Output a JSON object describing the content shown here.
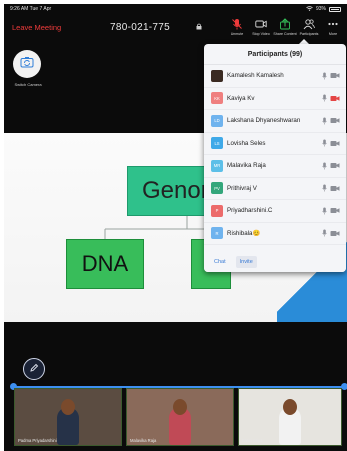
{
  "status_bar": {
    "time": "9:26 AM  Tue 7 Apr",
    "battery": "93%"
  },
  "toolbar": {
    "leave_label": "Leave Meeting",
    "meeting_id": "780-021-775",
    "tools": [
      {
        "label": "Unmute",
        "icon": "microphone-muted-icon",
        "color": "#ef3b3b"
      },
      {
        "label": "Stop Video",
        "icon": "video-camera-icon",
        "color": "#d9d9d9"
      },
      {
        "label": "Share Content",
        "icon": "share-arrow-icon",
        "color": "#36c25a"
      },
      {
        "label": "Participants",
        "icon": "participants-icon",
        "color": "#d9d9d9"
      },
      {
        "label": "More",
        "icon": "more-dots-icon",
        "color": "#d9d9d9"
      }
    ]
  },
  "switch_camera": {
    "label": "Switch Camera"
  },
  "slide": {
    "top_box": "Genom",
    "left_box": "DNA",
    "colors": {
      "top": "#2fc18b",
      "boxes": "#38bd5a",
      "accent": "#2a8cd8"
    }
  },
  "participants_panel": {
    "title": "Participants (99)",
    "participants": [
      {
        "name": "Kamalesh Kamalesh",
        "initials": "",
        "avatar_color": "#3a2a22",
        "mic_muted": true,
        "video_off": true
      },
      {
        "name": "Kaviya Kv",
        "initials": "KK",
        "avatar_color": "#ef7f7f",
        "mic_muted": true,
        "video_off": true,
        "video_red": true
      },
      {
        "name": "Lakshana Dhyaneshwaran",
        "initials": "LD",
        "avatar_color": "#6fb3ee",
        "mic_muted": true,
        "video_off": true
      },
      {
        "name": "Lovisha Seles",
        "initials": "LS",
        "avatar_color": "#3fa9e8",
        "mic_muted": true,
        "video_off": true
      },
      {
        "name": "Malavika Raja",
        "initials": "MR",
        "avatar_color": "#5cbfe8",
        "mic_muted": true,
        "video_off": true
      },
      {
        "name": "Prithivraj V",
        "initials": "PV",
        "avatar_color": "#33a67b",
        "mic_muted": true,
        "video_off": true
      },
      {
        "name": "Priyadharshini.C",
        "initials": "P",
        "avatar_color": "#ec6b6b",
        "mic_muted": true,
        "video_off": true
      },
      {
        "name": "Rishibala😊",
        "initials": "R",
        "avatar_color": "#6fb3ee",
        "mic_muted": true,
        "video_off": true
      }
    ],
    "footer": {
      "chat_label": "Chat",
      "invite_label": "Invite"
    }
  },
  "thumbnails": [
    {
      "name": "Padma Priyadarshini",
      "bg": "#5b4c41",
      "shirt": "#263248"
    },
    {
      "name": "Malavika Raja",
      "bg": "#8a6a5a",
      "shirt": "#c04a56"
    },
    {
      "name": "harini priya",
      "bg": "#e6e4df",
      "shirt": "#f2f2f2"
    }
  ]
}
